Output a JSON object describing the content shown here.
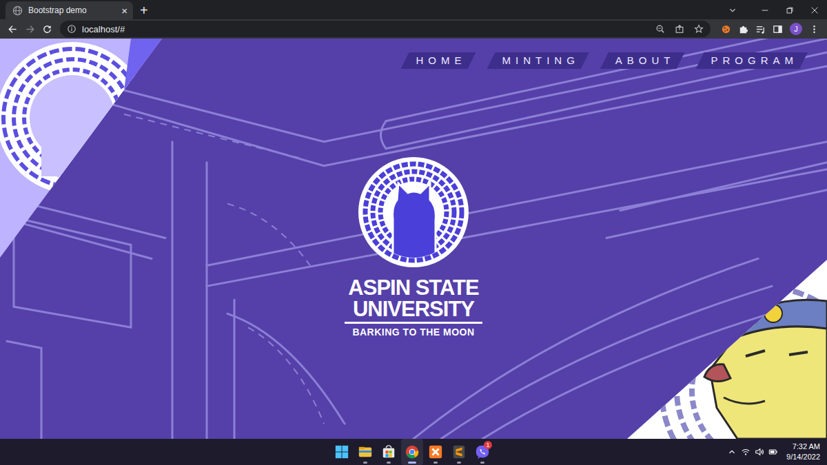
{
  "browser": {
    "tabs": [
      {
        "title": "Bootstrap demo",
        "selected": true,
        "close": "×"
      }
    ],
    "new_tab": "+",
    "address": "localhost/#",
    "profile": "J"
  },
  "nav": {
    "items": [
      {
        "label": "HOME"
      },
      {
        "label": "MINTING"
      },
      {
        "label": "ABOUT"
      },
      {
        "label": "PROGRAM"
      }
    ]
  },
  "hero": {
    "title_lines": [
      "ASPIN STATE",
      "UNIVERSITY"
    ],
    "tagline": "BARKING TO THE MOON"
  },
  "taskbar": {
    "apps": [
      {
        "kind": "start",
        "running": false,
        "active": false,
        "badge": ""
      },
      {
        "kind": "explorer",
        "running": true,
        "active": false,
        "badge": ""
      },
      {
        "kind": "store",
        "running": true,
        "active": false,
        "badge": ""
      },
      {
        "kind": "chrome",
        "running": true,
        "active": true,
        "badge": ""
      },
      {
        "kind": "xampp",
        "running": true,
        "active": false,
        "badge": ""
      },
      {
        "kind": "sublime",
        "running": true,
        "active": false,
        "badge": ""
      },
      {
        "kind": "viber",
        "running": true,
        "active": false,
        "badge": "1"
      }
    ],
    "time": "7:32 AM",
    "date": "9/14/2022"
  }
}
